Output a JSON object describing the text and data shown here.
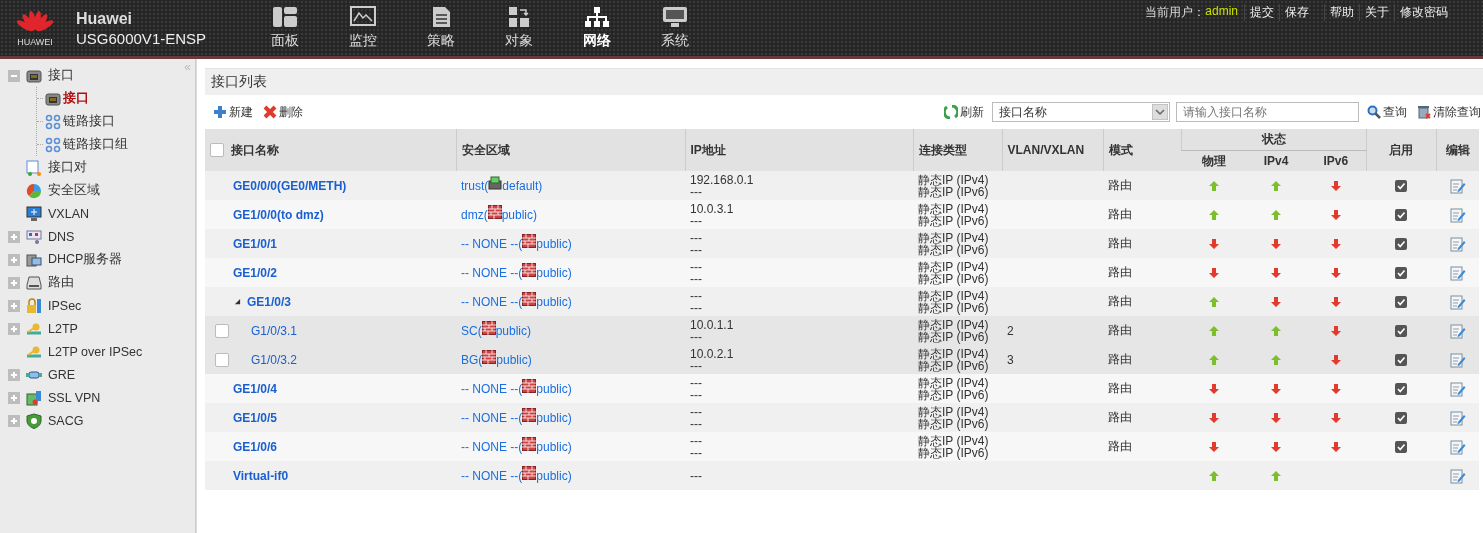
{
  "header": {
    "logo_text": "HUAWEI",
    "brand": "Huawei",
    "model": "USG6000V1-ENSP",
    "nav": [
      {
        "label": "面板",
        "kind": "dashboard",
        "selected": false
      },
      {
        "label": "监控",
        "kind": "monitor",
        "selected": false
      },
      {
        "label": "策略",
        "kind": "document",
        "selected": false
      },
      {
        "label": "对象",
        "kind": "object",
        "selected": false
      },
      {
        "label": "网络",
        "kind": "network",
        "selected": true
      },
      {
        "label": "系统",
        "kind": "system",
        "selected": false
      }
    ],
    "user_label": "当前用户：",
    "user": "admin",
    "links": [
      {
        "label": "提交"
      },
      {
        "label": "保存"
      },
      {
        "label": "帮助"
      },
      {
        "label": "关于"
      },
      {
        "label": "修改密码"
      }
    ]
  },
  "sidebar": {
    "collapse": "«",
    "items": [
      {
        "label": "接口",
        "kind": "port",
        "expanded": true,
        "selected": false,
        "children": [
          {
            "label": "接口",
            "kind": "port",
            "selected": true
          },
          {
            "label": "链路接口",
            "kind": "link",
            "selected": false
          },
          {
            "label": "链路接口组",
            "kind": "link",
            "selected": false
          }
        ]
      },
      {
        "label": "接口对",
        "kind": "pair",
        "selected": false
      },
      {
        "label": "安全区域",
        "kind": "zone",
        "selected": false
      },
      {
        "label": "VXLAN",
        "kind": "screen",
        "selected": false
      },
      {
        "label": "DNS",
        "kind": "dns",
        "expanded": false,
        "selected": false
      },
      {
        "label": "DHCP服务器",
        "kind": "server",
        "expanded": false,
        "selected": false
      },
      {
        "label": "路由",
        "kind": "router",
        "expanded": false,
        "selected": false
      },
      {
        "label": "IPSec",
        "kind": "lock",
        "expanded": false,
        "selected": false
      },
      {
        "label": "L2TP",
        "kind": "key",
        "expanded": false,
        "selected": false
      },
      {
        "label": "L2TP over IPSec",
        "kind": "key",
        "selected": false
      },
      {
        "label": "GRE",
        "kind": "pipe",
        "expanded": false,
        "selected": false
      },
      {
        "label": "SSL VPN",
        "kind": "cert",
        "expanded": false,
        "selected": false
      },
      {
        "label": "SACG",
        "kind": "shield",
        "expanded": false,
        "selected": false
      }
    ]
  },
  "panel": {
    "title": "接口列表",
    "toolbar": {
      "new": "新建",
      "delete": "删除",
      "refresh": "刷新",
      "filter": "接口名称",
      "search": {
        "placeholder": "请输入接口名称"
      },
      "query": "查询",
      "clear": "清除查询"
    },
    "table": {
      "header_checked": false,
      "columns": [
        "接口名称",
        "安全区域",
        "IP地址",
        "连接类型",
        "VLAN/VXLAN",
        "模式"
      ],
      "status_group": "状态",
      "status_columns": [
        "物理",
        "IPv4",
        "IPv6"
      ],
      "enabled_column": "启用",
      "edit_column": "编辑",
      "rows": [
        {
          "kind": "interface",
          "name": "GE0/0/0(GE0/METH)",
          "zone": {
            "kind": "host",
            "name": "trust(",
            "vsys": "default)"
          },
          "ip": [
            "192.168.0.1",
            "---"
          ],
          "connection": [
            "静态IP (IPv4)",
            "静态IP (IPv6)"
          ],
          "mode": "路由",
          "physical_up": true,
          "ipv4_up": true,
          "ipv6_up": false,
          "enabled": true
        },
        {
          "kind": "interface",
          "name": "GE1/0/0(to dmz)",
          "zone": {
            "kind": "firewall",
            "name": "dmz(",
            "vsys": "public)"
          },
          "ip": [
            "10.0.3.1",
            "---"
          ],
          "connection": [
            "静态IP (IPv4)",
            "静态IP (IPv6)"
          ],
          "mode": "路由",
          "physical_up": true,
          "ipv4_up": true,
          "ipv6_up": false,
          "enabled": true
        },
        {
          "kind": "interface",
          "name": "GE1/0/1",
          "zone": {
            "kind": "firewall",
            "name": "-- NONE --(",
            "vsys": "public)"
          },
          "ip": [
            "---",
            "---"
          ],
          "connection": [
            "静态IP (IPv4)",
            "静态IP (IPv6)"
          ],
          "mode": "路由",
          "physical_up": false,
          "ipv4_up": false,
          "ipv6_up": false,
          "enabled": true
        },
        {
          "kind": "interface",
          "name": "GE1/0/2",
          "zone": {
            "kind": "firewall",
            "name": "-- NONE --(",
            "vsys": "public)"
          },
          "ip": [
            "---",
            "---"
          ],
          "connection": [
            "静态IP (IPv4)",
            "静态IP (IPv6)"
          ],
          "mode": "路由",
          "physical_up": false,
          "ipv4_up": false,
          "ipv6_up": false,
          "enabled": true
        },
        {
          "kind": "parent",
          "expanded": true,
          "name": "GE1/0/3",
          "zone": {
            "kind": "firewall",
            "name": "-- NONE --(",
            "vsys": "public)"
          },
          "ip": [
            "---",
            "---"
          ],
          "connection": [
            "静态IP (IPv4)",
            "静态IP (IPv6)"
          ],
          "mode": "路由",
          "physical_up": true,
          "ipv4_up": false,
          "ipv6_up": false,
          "enabled": true
        },
        {
          "kind": "subinterface",
          "checked": false,
          "name": "G1/0/3.1",
          "zone": {
            "kind": "firewall",
            "name": "SC(",
            "vsys": "public)"
          },
          "ip": [
            "10.0.1.1",
            "---"
          ],
          "connection": [
            "静态IP (IPv4)",
            "静态IP (IPv6)"
          ],
          "vlan": "2",
          "mode": "路由",
          "physical_up": true,
          "ipv4_up": true,
          "ipv6_up": false,
          "enabled": true
        },
        {
          "kind": "subinterface",
          "checked": false,
          "name": "G1/0/3.2",
          "zone": {
            "kind": "firewall",
            "name": "BG(",
            "vsys": "public)"
          },
          "ip": [
            "10.0.2.1",
            "---"
          ],
          "connection": [
            "静态IP (IPv4)",
            "静态IP (IPv6)"
          ],
          "vlan": "3",
          "mode": "路由",
          "physical_up": true,
          "ipv4_up": true,
          "ipv6_up": false,
          "enabled": true
        },
        {
          "kind": "interface",
          "name": "GE1/0/4",
          "zone": {
            "kind": "firewall",
            "name": "-- NONE --(",
            "vsys": "public)"
          },
          "ip": [
            "---",
            "---"
          ],
          "connection": [
            "静态IP (IPv4)",
            "静态IP (IPv6)"
          ],
          "mode": "路由",
          "physical_up": false,
          "ipv4_up": false,
          "ipv6_up": false,
          "enabled": true
        },
        {
          "kind": "interface",
          "name": "GE1/0/5",
          "zone": {
            "kind": "firewall",
            "name": "-- NONE --(",
            "vsys": "public)"
          },
          "ip": [
            "---",
            "---"
          ],
          "connection": [
            "静态IP (IPv4)",
            "静态IP (IPv6)"
          ],
          "mode": "路由",
          "physical_up": false,
          "ipv4_up": false,
          "ipv6_up": false,
          "enabled": true
        },
        {
          "kind": "interface",
          "name": "GE1/0/6",
          "zone": {
            "kind": "firewall",
            "name": "-- NONE --(",
            "vsys": "public)"
          },
          "ip": [
            "---",
            "---"
          ],
          "connection": [
            "静态IP (IPv4)",
            "静态IP (IPv6)"
          ],
          "mode": "路由",
          "physical_up": false,
          "ipv4_up": false,
          "ipv6_up": false,
          "enabled": true
        },
        {
          "kind": "interface",
          "name": "Virtual-if0",
          "zone": {
            "kind": "firewall",
            "name": "-- NONE --(",
            "vsys": "public)"
          },
          "ip": [
            "---"
          ],
          "physical_up": true,
          "ipv4_up": true
        }
      ]
    }
  }
}
